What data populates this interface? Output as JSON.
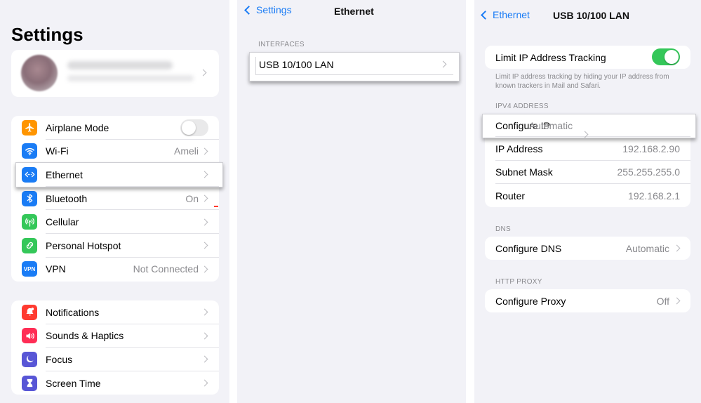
{
  "settings": {
    "title": "Settings",
    "group1": [
      {
        "label": "Airplane Mode",
        "value": "",
        "icon": "airplane-icon",
        "color": "#ff9500",
        "control": "toggle-off"
      },
      {
        "label": "Wi-Fi",
        "value": "Ameli",
        "icon": "wifi-icon",
        "color": "#1a7cf5",
        "control": "chevron"
      },
      {
        "label": "Ethernet",
        "value": "",
        "icon": "ethernet-icon",
        "color": "#1a7cf5",
        "control": "chevron"
      },
      {
        "label": "Bluetooth",
        "value": "On",
        "icon": "bluetooth-icon",
        "color": "#1a7cf5",
        "control": "chevron"
      },
      {
        "label": "Cellular",
        "value": "",
        "icon": "antenna-icon",
        "color": "#34c759",
        "control": "chevron"
      },
      {
        "label": "Personal Hotspot",
        "value": "",
        "icon": "hotspot-icon",
        "color": "#34c759",
        "control": "chevron"
      },
      {
        "label": "VPN",
        "value": "Not Connected",
        "icon": "vpn-icon",
        "color": "#1a7cf5",
        "control": "chevron"
      }
    ],
    "group2": [
      {
        "label": "Notifications",
        "icon": "bell-icon",
        "color": "#ff3b30"
      },
      {
        "label": "Sounds & Haptics",
        "icon": "speaker-icon",
        "color": "#ff2d55"
      },
      {
        "label": "Focus",
        "icon": "moon-icon",
        "color": "#5856d6"
      },
      {
        "label": "Screen Time",
        "icon": "hourglass-icon",
        "color": "#5856d6"
      }
    ],
    "vpn_icon_text": "VPN"
  },
  "ethernet": {
    "back_label": "Settings",
    "title": "Ethernet",
    "section": "INTERFACES",
    "interface": "USB 10/100 LAN"
  },
  "lan": {
    "back_label": "Ethernet",
    "title": "USB 10/100 LAN",
    "tracking_label": "Limit IP Address Tracking",
    "tracking_footnote_1": "Limit IP address tracking by hiding your IP address from",
    "tracking_footnote_2": "known trackers in Mail and Safari.",
    "ipv4_header": "IPV4 ADDRESS",
    "ipv4_rows": [
      {
        "label": "Configure IP",
        "value": "Automatic"
      },
      {
        "label": "IP Address",
        "value": "192.168.2.90"
      },
      {
        "label": "Subnet Mask",
        "value": "255.255.255.0"
      },
      {
        "label": "Router",
        "value": "192.168.2.1"
      }
    ],
    "dns_header": "DNS",
    "dns_label": "Configure DNS",
    "dns_value": "Automatic",
    "proxy_header": "HTTP PROXY",
    "proxy_label": "Configure Proxy",
    "proxy_value": "Off"
  }
}
